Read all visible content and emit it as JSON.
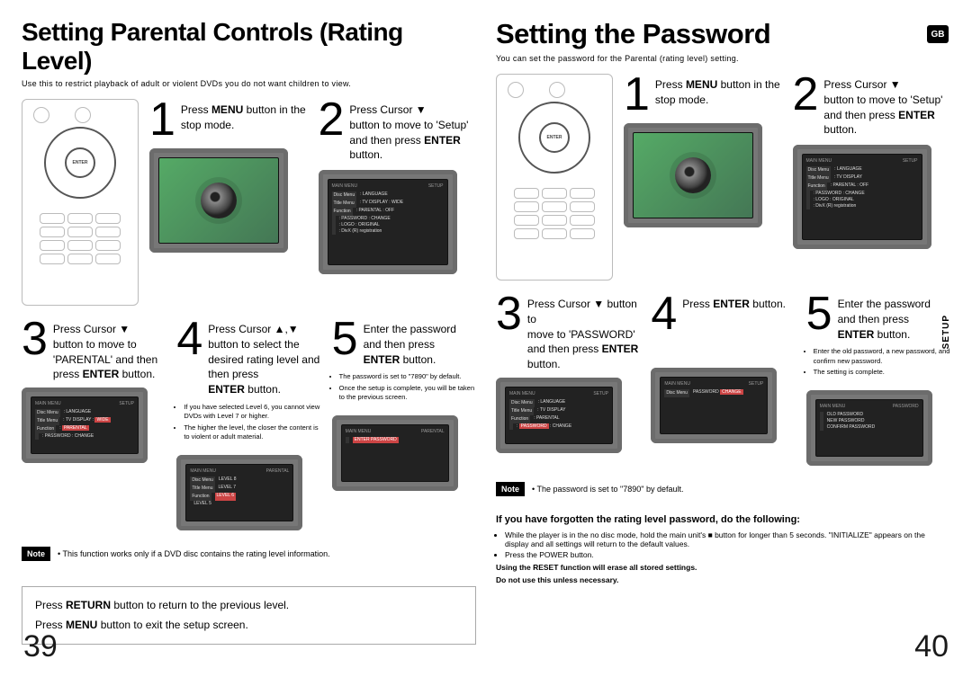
{
  "badge": "GB",
  "sidetab": "SETUP",
  "noteLabel": "Note",
  "osd": {
    "main": "MAIN MENU",
    "setup": "SETUP",
    "par": "PARENTAL",
    "pwd": "PASSWORD",
    "lang": "LANGUAGE",
    "tv": "TV DISPLAY",
    "wide": "WIDE",
    "off": "OFF",
    "change": "CHANGE",
    "logo": "LOGO",
    "orig": "ORIGINAL",
    "divx": "DivX (R) registration",
    "enterpwd": "ENTER PASSWORD",
    "oldpwd": "OLD PASSWORD",
    "newpwd": "NEW PASSWORD",
    "confpwd": "CONFIRM PASSWORD",
    "sideA": [
      "Disc Menu",
      "Title Menu",
      "Function"
    ]
  },
  "left": {
    "title": "Setting Parental Controls (Rating Level)",
    "sub": "Use this to restrict playback of adult or violent DVDs you do not want children to view.",
    "page": "39",
    "s1": {
      "n": "1",
      "b1": "MENU",
      "t": "button in the stop mode."
    },
    "s2": {
      "n": "2",
      "t1": "Press Cursor ▼",
      "t2": "button to move to 'Setup' and then press",
      "b": "ENTER",
      "t3": "button."
    },
    "s3": {
      "n": "3",
      "t1": "Press Cursor ▼",
      "t2": "button to move to 'PARENTAL' and then press",
      "b": "ENTER",
      "t3": "button."
    },
    "s4": {
      "n": "4",
      "t1": "Press Cursor ▲,▼ button to select the desired rating level and then press",
      "b": "ENTER",
      "t2": "button.",
      "note1": "If you have selected Level 6, you cannot view DVDs with Level 7 or higher.",
      "note2": "The higher the level, the closer the content is to violent or adult material."
    },
    "s5": {
      "n": "5",
      "t1": "Enter the password and then press",
      "b": "ENTER",
      "t2": "button.",
      "note1": "The password is set to \"7890\" by default.",
      "note2": "Once the setup is complete, you will be taken to the previous screen."
    },
    "note": "• This function works only if a DVD disc contains the rating level information.",
    "foot": {
      "b1": "RETURN",
      "t1": "button to return to the previous level.",
      "b2": "MENU",
      "t2": "button to exit the setup screen."
    }
  },
  "right": {
    "title": "Setting the Password",
    "sub": "You can set the password for the Parental (rating level) setting.",
    "page": "40",
    "s1": {
      "n": "1",
      "b1": "MENU",
      "t": "button in the stop mode."
    },
    "s2": {
      "n": "2",
      "t1": "Press Cursor ▼",
      "t2": "button to move to 'Setup' and then press",
      "b": "ENTER",
      "t3": "button."
    },
    "s3": {
      "n": "3",
      "t1": "Press Cursor ▼ button to",
      "t2": "move to 'PASSWORD' and then press",
      "b": "ENTER",
      "t3": "button."
    },
    "s4": {
      "n": "4",
      "b": "ENTER",
      "t": "button."
    },
    "s5": {
      "n": "5",
      "t1": "Enter the password and then press",
      "b": "ENTER",
      "t2": "button.",
      "note1": "Enter the old password, a new password, and confirm new password.",
      "note2": "The setting is complete."
    },
    "note": "• The password is set to \"7890\" by default.",
    "forgot": {
      "h": "If you have forgotten the rating level password, do the following:",
      "b1": "While the player is in the no disc mode, hold the main unit's ■ button for longer than 5 seconds. \"INITIALIZE\" appears on the display and all settings will return to the default values.",
      "b2": "Press the POWER button.",
      "w1": "Using the RESET function will erase all stored settings.",
      "w2": "Do not use this unless necessary."
    }
  }
}
